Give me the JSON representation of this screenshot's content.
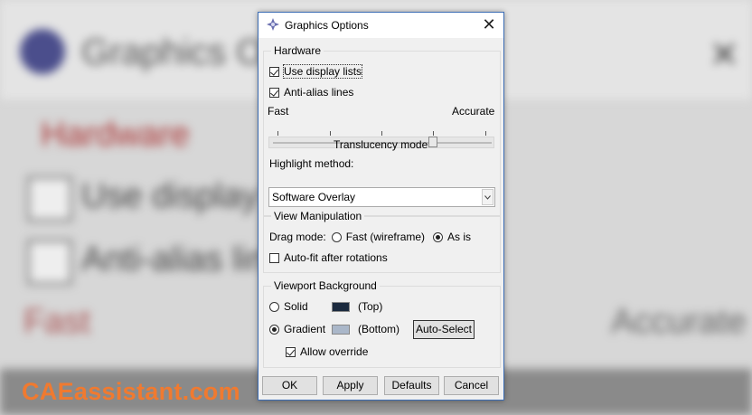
{
  "background": {
    "title": "Graphics Op",
    "section": "Hardware",
    "item1": "Use display",
    "item2": "Anti-alias lin",
    "fast": "Fast",
    "accurate": "Accurate"
  },
  "watermark": "CAEassistant.com",
  "dialog": {
    "title": "Graphics Options",
    "close_icon": "close-icon",
    "hardware": {
      "legend": "Hardware",
      "use_display_lists": {
        "label": "Use display lists",
        "checked": true
      },
      "anti_alias_lines": {
        "label": "Anti-alias lines",
        "checked": true
      },
      "slider_left": "Fast",
      "slider_right": "Accurate",
      "slider_value": 0.73,
      "slider_caption": "Translucency mode",
      "highlight_label": "Highlight method:",
      "highlight_value": "Software Overlay"
    },
    "view_manipulation": {
      "legend": "View Manipulation",
      "drag_mode_label": "Drag mode:",
      "option_fast": "Fast (wireframe)",
      "option_asis": "As is",
      "selected": "As is",
      "auto_fit": {
        "label": "Auto-fit after rotations",
        "checked": false
      }
    },
    "viewport_background": {
      "legend": "Viewport Background",
      "solid_label": "Solid",
      "top_label": "(Top)",
      "gradient_label": "Gradient",
      "bottom_label": "(Bottom)",
      "selected": "Gradient",
      "top_color": "#1b2a3e",
      "bottom_color": "#aab7c9",
      "auto_select": "Auto-Select",
      "allow_override": {
        "label": "Allow override",
        "checked": true
      }
    },
    "buttons": {
      "ok": "OK",
      "apply": "Apply",
      "defaults": "Defaults",
      "cancel": "Cancel"
    }
  }
}
